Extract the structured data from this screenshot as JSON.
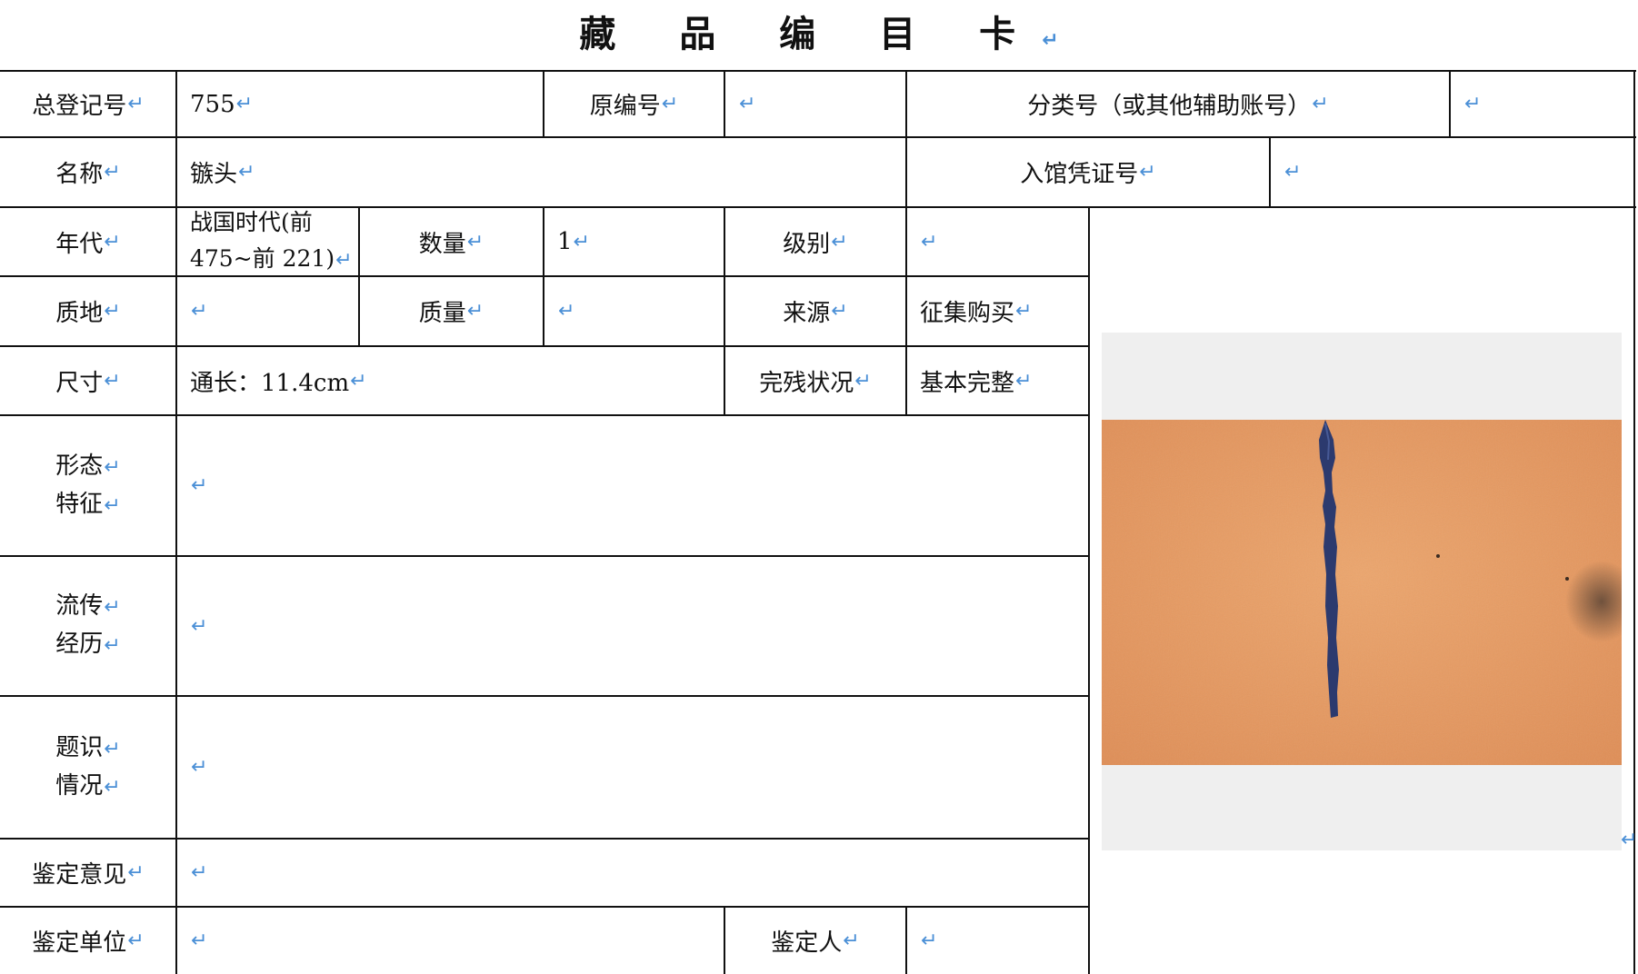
{
  "title": "藏 品 编 目 卡",
  "return_mark": "↵",
  "fields": {
    "registration_no_label": "总登记号",
    "registration_no_value": "755",
    "original_no_label": "原编号",
    "original_no_value": "",
    "class_no_label": "分类号（或其他辅助账号）",
    "class_no_value": "",
    "name_label": "名称",
    "name_value": "镞头",
    "voucher_label": "入馆凭证号",
    "voucher_value": "",
    "era_label": "年代",
    "era_value_line1": "战国时代(前",
    "era_value_line2": "475~前 221)",
    "quantity_label": "数量",
    "quantity_value": "1",
    "grade_label": "级别",
    "grade_value": "",
    "material_label": "质地",
    "material_value": "",
    "mass_label": "质量",
    "mass_value": "",
    "source_label": "来源",
    "source_value": "征集购买",
    "size_label": "尺寸",
    "size_value": "通长：11.4cm",
    "condition_label": "完残状况",
    "condition_value": "基本完整",
    "shape_label_line1": "形态",
    "shape_label_line2": "特征",
    "shape_value": "",
    "provenance_label_line1": "流传",
    "provenance_label_line2": "经历",
    "provenance_value": "",
    "inscription_label_line1": "题识",
    "inscription_label_line2": "情况",
    "inscription_value": "",
    "appraisal_opinion_label": "鉴定意见",
    "appraisal_opinion_value": "",
    "appraisal_unit_label": "鉴定单位",
    "appraisal_unit_value": "",
    "appraiser_label": "鉴定人",
    "appraiser_value": ""
  },
  "photo": {
    "subject": "iron arrowhead on orange textured background",
    "background_color": "#e79a5e",
    "object_color": "#2c3a6e"
  },
  "colors": {
    "grid": "#111111",
    "return_mark": "#4a8fd6"
  }
}
